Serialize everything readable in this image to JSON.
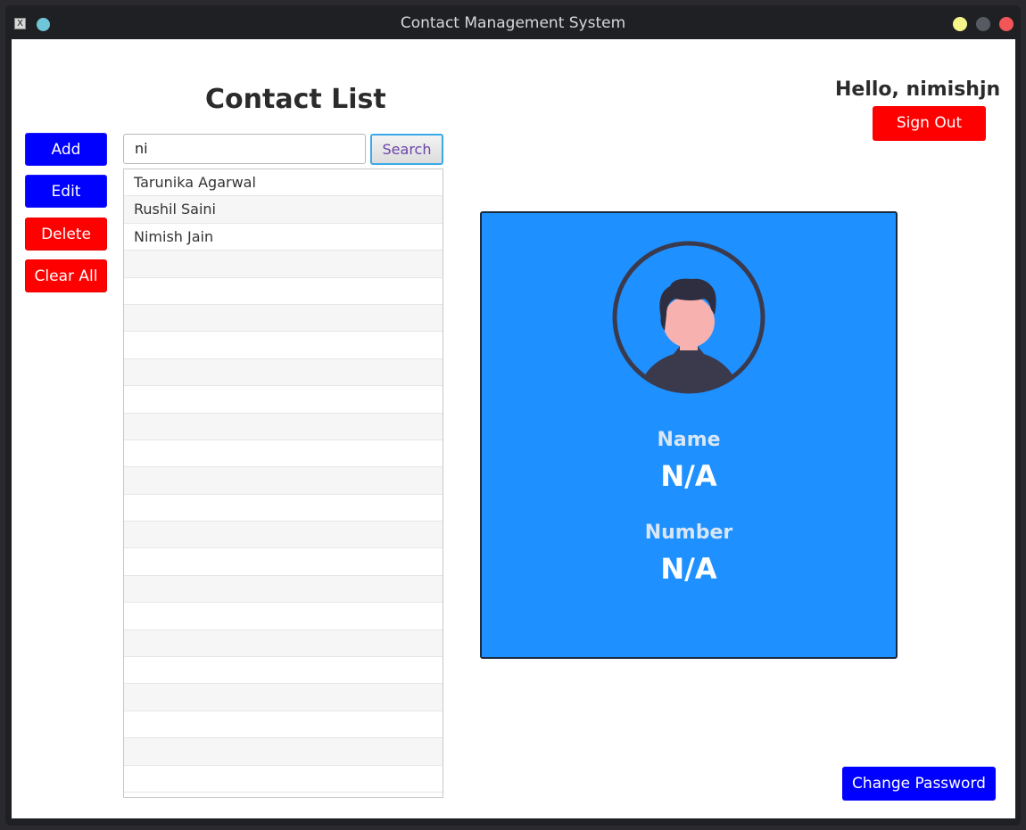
{
  "window": {
    "title": "Contact Management System",
    "app_icon": "X"
  },
  "main": {
    "heading": "Contact List",
    "greeting": "Hello, nimishjn",
    "sign_out_label": "Sign Out",
    "change_password_label": "Change Password"
  },
  "actions": {
    "add_label": "Add",
    "edit_label": "Edit",
    "delete_label": "Delete",
    "clear_all_label": "Clear All"
  },
  "search": {
    "value": "ni",
    "button_label": "Search"
  },
  "contacts": [
    "Tarunika Agarwal",
    "Rushil Saini",
    "Nimish Jain"
  ],
  "details": {
    "name_label": "Name",
    "name_value": "N/A",
    "number_label": "Number",
    "number_value": "N/A",
    "avatar_icon": "person-avatar-icon"
  },
  "colors": {
    "primary_blue": "#0000ff",
    "danger_red": "#ff0000",
    "card_blue": "#1e90ff"
  }
}
